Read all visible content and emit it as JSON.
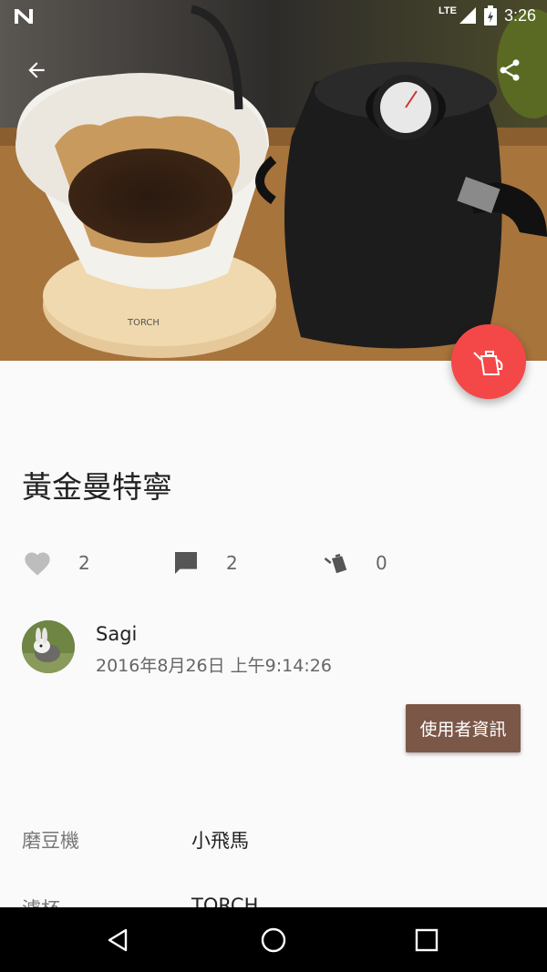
{
  "status_bar": {
    "network": "LTE",
    "time": "3:26"
  },
  "brew": {
    "title": "黃金曼特寧"
  },
  "stats": {
    "likes": "2",
    "comments": "2",
    "brews": "0"
  },
  "author": {
    "name": "Sagi",
    "timestamp": "2016年8月26日 上午9:14:26",
    "profile_button": "使用者資訊"
  },
  "details": [
    {
      "label": "磨豆機",
      "value": "小飛馬"
    },
    {
      "label": "濾杯",
      "value": "TORCH"
    }
  ],
  "colors": {
    "fab": "#f44848",
    "button": "#7b5748"
  }
}
